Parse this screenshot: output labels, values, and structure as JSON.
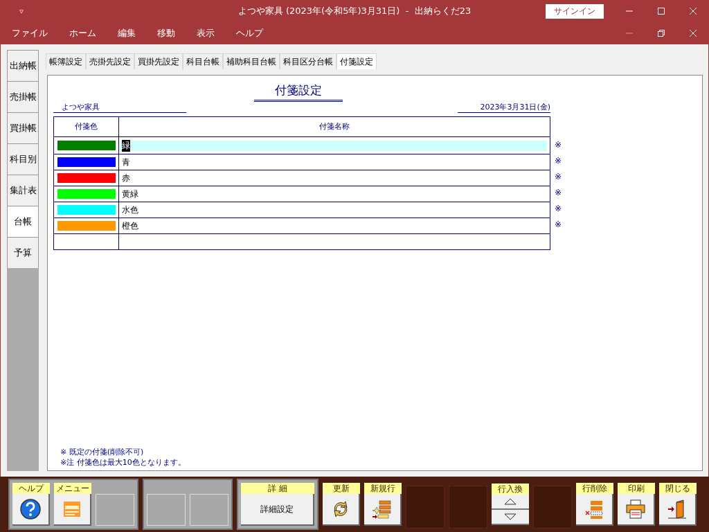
{
  "window": {
    "title": "よつや家具 (2023年(令和5年)3月31日)  -  出納らくだ23",
    "signin": "サインイン",
    "menu_glyph": "▿"
  },
  "menu": [
    "ファイル",
    "ホーム",
    "編集",
    "移動",
    "表示",
    "ヘルプ"
  ],
  "side_tabs": [
    {
      "label": "出納帳",
      "selected": false
    },
    {
      "label": "売掛帳",
      "selected": false
    },
    {
      "label": "買掛帳",
      "selected": false
    },
    {
      "label": "科目別",
      "selected": false
    },
    {
      "label": "集計表",
      "selected": false
    },
    {
      "label": "台帳",
      "selected": true
    },
    {
      "label": "予算",
      "selected": false
    }
  ],
  "tabs": [
    {
      "label": "帳簿設定",
      "selected": false
    },
    {
      "label": "売掛先設定",
      "selected": false
    },
    {
      "label": "買掛先設定",
      "selected": false
    },
    {
      "label": "科目台帳",
      "selected": false
    },
    {
      "label": "補助科目台帳",
      "selected": false
    },
    {
      "label": "科目区分台帳",
      "selected": false
    },
    {
      "label": "付箋設定",
      "selected": true
    }
  ],
  "sheet": {
    "title": "付箋設定",
    "company": "よつや家具",
    "date": "2023年3月31日(金)",
    "columns": [
      "付箋色",
      "付箋名称"
    ],
    "rows": [
      {
        "color": "#007f00",
        "name": "緑",
        "selected": true,
        "mark": "※"
      },
      {
        "color": "#0000ff",
        "name": "青",
        "selected": false,
        "mark": "※"
      },
      {
        "color": "#ff0000",
        "name": "赤",
        "selected": false,
        "mark": "※"
      },
      {
        "color": "#00ff00",
        "name": "黄緑",
        "selected": false,
        "mark": "※"
      },
      {
        "color": "#00ffff",
        "name": "水色",
        "selected": false,
        "mark": "※"
      },
      {
        "color": "#ff9900",
        "name": "橙色",
        "selected": false,
        "mark": "※"
      }
    ],
    "notes": [
      "※ 既定の付箋(削除不可)",
      "※注  付箋色は最大10色となります。"
    ]
  },
  "toolbar": [
    {
      "kind": "group",
      "items": [
        {
          "kind": "help",
          "label": "ヘルプ"
        },
        {
          "kind": "menu",
          "label": "メニュー"
        },
        {
          "kind": "slot"
        }
      ]
    },
    {
      "kind": "group",
      "items": [
        {
          "kind": "slot"
        },
        {
          "kind": "slot"
        }
      ]
    },
    {
      "kind": "group",
      "items": [
        {
          "kind": "text",
          "label": "詳 細",
          "text": "詳細設定"
        }
      ]
    },
    {
      "kind": "refresh",
      "label": "更新"
    },
    {
      "kind": "new_row",
      "label": "新規行"
    },
    {
      "kind": "dark"
    },
    {
      "kind": "dark"
    },
    {
      "kind": "swap",
      "label": "行入換"
    },
    {
      "kind": "dark"
    },
    {
      "kind": "delete_row",
      "label": "行削除"
    },
    {
      "kind": "print",
      "label": "印刷"
    },
    {
      "kind": "close",
      "label": "閉じる"
    }
  ]
}
